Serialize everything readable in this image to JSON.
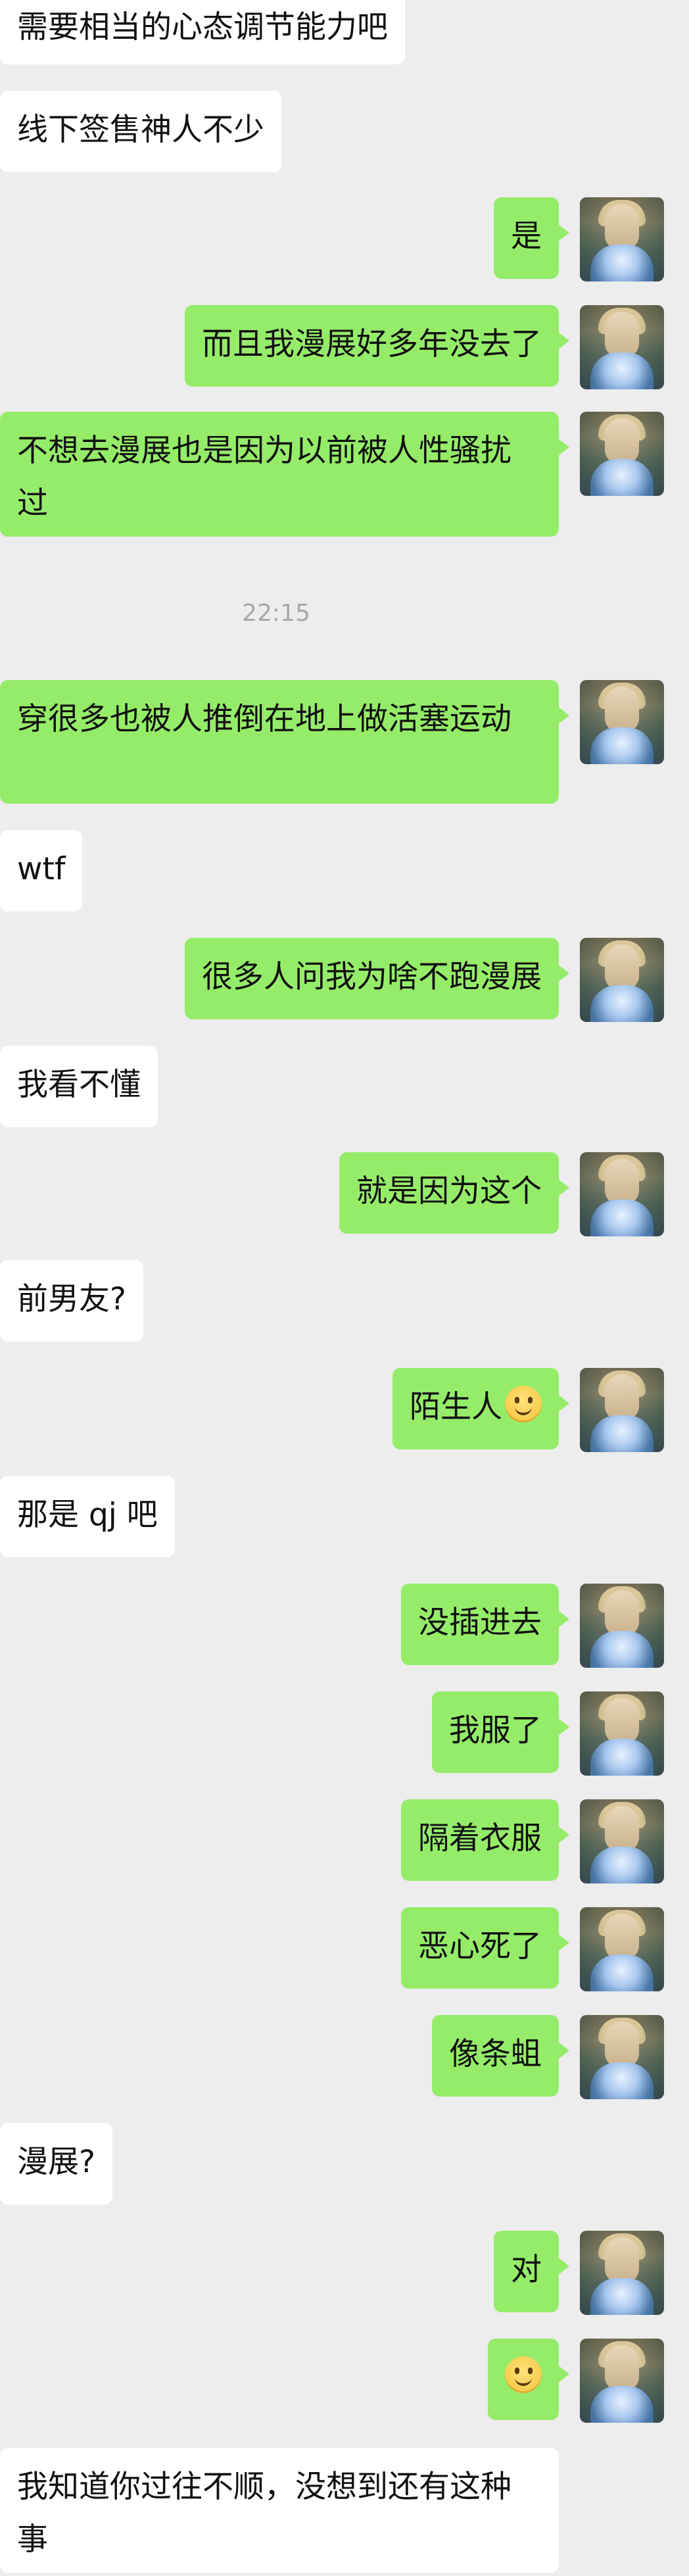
{
  "messages": [
    {
      "side": "in",
      "text": "需要相当的心态调节能力吧"
    },
    {
      "side": "in",
      "text": "线下签售神人不少"
    },
    {
      "side": "out",
      "text": "是"
    },
    {
      "side": "out",
      "text": "而且我漫展好多年没去了"
    },
    {
      "side": "out",
      "text": "不想去漫展也是因为以前被人性骚扰过"
    },
    {
      "side": "out",
      "text": "穿很多也被人推倒在地上做活塞运动"
    },
    {
      "side": "in",
      "text": "wtf"
    },
    {
      "side": "out",
      "text": "很多人问我为啥不跑漫展"
    },
    {
      "side": "in",
      "text": "我看不懂"
    },
    {
      "side": "out",
      "text": "就是因为这个"
    },
    {
      "side": "in",
      "text": "前男友?"
    },
    {
      "side": "out",
      "text": "陌生人"
    },
    {
      "side": "in",
      "text": "那是 qj 吧"
    },
    {
      "side": "out",
      "text": "没插进去"
    },
    {
      "side": "out",
      "text": "我服了"
    },
    {
      "side": "out",
      "text": "隔着衣服"
    },
    {
      "side": "out",
      "text": "恶心死了"
    },
    {
      "side": "out",
      "text": "像条蛆"
    },
    {
      "side": "in",
      "text": "漫展?"
    },
    {
      "side": "out",
      "text": "对"
    },
    {
      "side": "out",
      "text": ""
    },
    {
      "side": "in",
      "text": "我知道你过往不顺，没想到还有这种事"
    }
  ],
  "timestamp": "22:15",
  "emoji_name": "smile-emoji",
  "colors": {
    "background": "#ededed",
    "outgoing_bubble": "#95ec69",
    "incoming_bubble": "#ffffff",
    "timestamp": "#a8a8a8"
  }
}
